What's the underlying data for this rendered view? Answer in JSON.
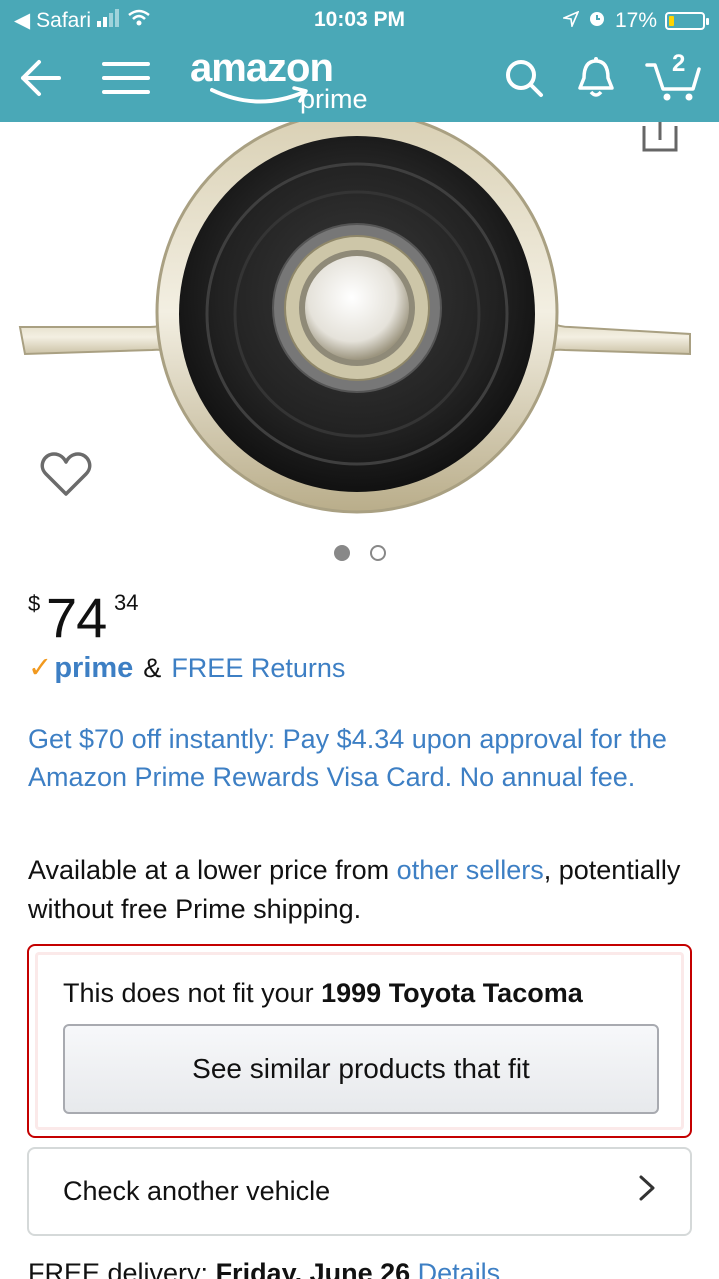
{
  "status_bar": {
    "carrier": "Safari",
    "time": "10:03 PM",
    "battery_pct": "17%",
    "battery_level": 0.17
  },
  "nav": {
    "logo_word": "amazon",
    "logo_sub": "prime",
    "cart_count": "2"
  },
  "product": {
    "image_dots": 2,
    "active_dot": 0
  },
  "price": {
    "currency": "$",
    "whole": "74",
    "fraction": "34"
  },
  "prime_row": {
    "badge": "prime",
    "amp": "&",
    "returns": "FREE Returns"
  },
  "offer": {
    "text": "Get $70 off instantly: Pay $4.34 upon approval for the Amazon Prime Rewards Visa Card. No annual fee."
  },
  "availability": {
    "prefix": "Available at a lower price from ",
    "link": "other sellers",
    "suffix": ", potentially without free Prime shipping."
  },
  "fit": {
    "text": "This does not fit your ",
    "vehicle": "1999 Toyota Tacoma",
    "button": "See similar products that fit"
  },
  "check_vehicle": {
    "label": "Check another vehicle"
  },
  "delivery": {
    "prefix": "FREE delivery: ",
    "date": "Friday, June 26",
    "link": "Details"
  },
  "colors": {
    "header": "#4aa8b7",
    "link": "#3d7fc4",
    "prime_check": "#f1991f",
    "fit_border": "#c40000"
  }
}
